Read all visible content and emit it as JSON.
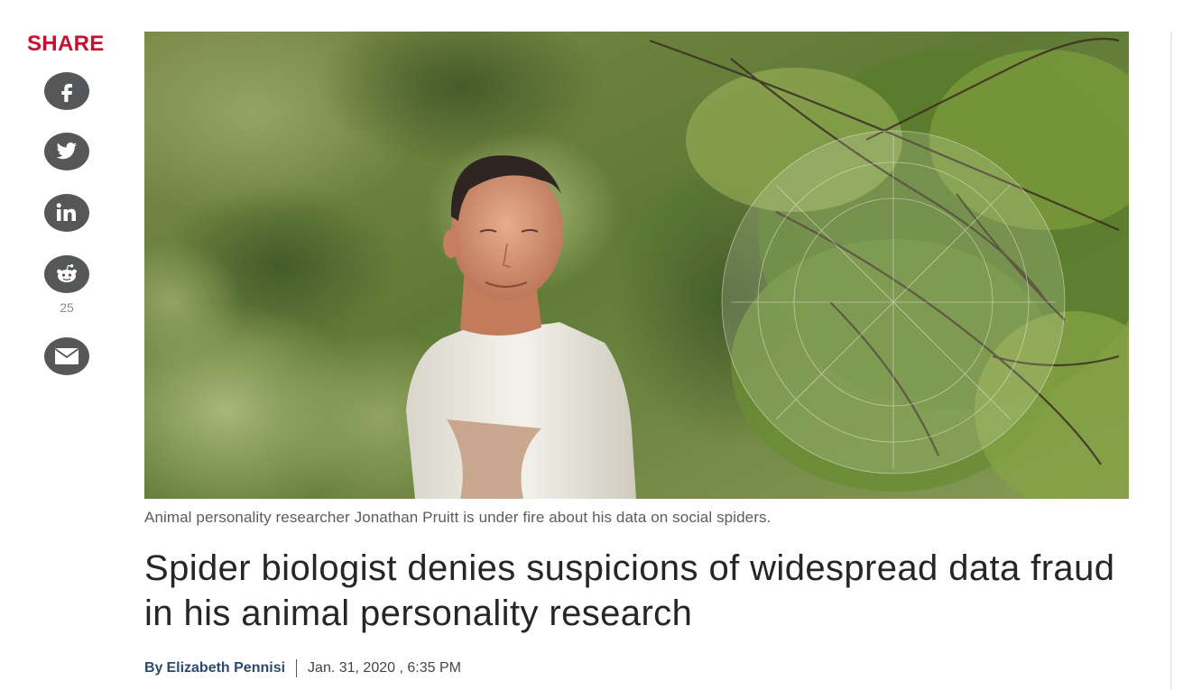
{
  "share": {
    "label": "SHARE",
    "buttons": [
      {
        "icon": "facebook-icon"
      },
      {
        "icon": "twitter-icon"
      },
      {
        "icon": "linkedin-icon"
      },
      {
        "icon": "reddit-icon",
        "count": "25"
      },
      {
        "icon": "email-icon"
      }
    ],
    "icon_bg": "#555759"
  },
  "article": {
    "image_caption": "Animal personality researcher Jonathan Pruitt is under fire about his data on social spiders.",
    "headline": "Spider biologist denies suspicions of widespread data fraud in his animal personality research",
    "byline_prefix": "By",
    "author": "Elizabeth Pennisi",
    "date": "Jan. 31, 2020 , 6:35 PM"
  },
  "colors": {
    "share_red": "#c8102e",
    "author_blue": "#2c4a6b",
    "headline": "#262626"
  }
}
